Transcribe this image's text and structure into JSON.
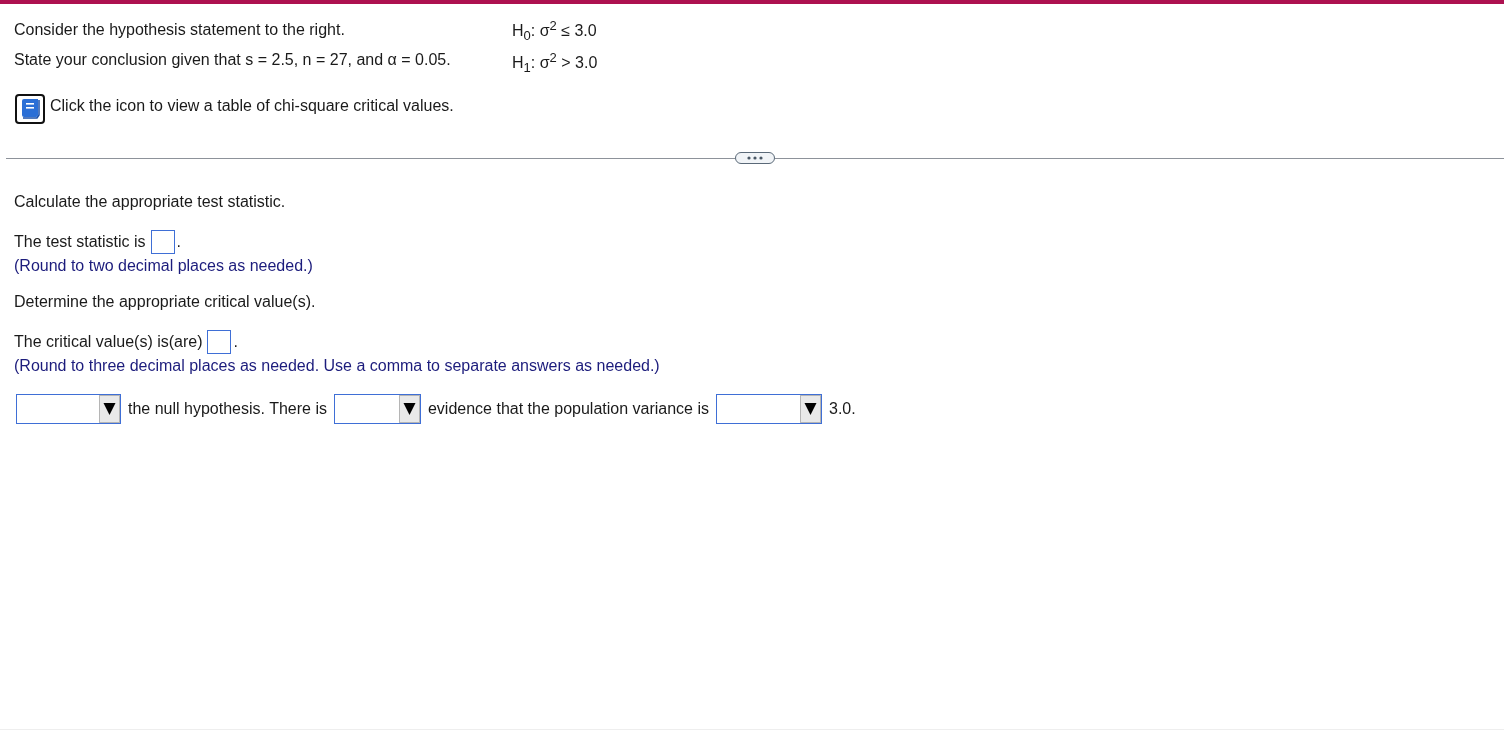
{
  "problem": {
    "statements": [
      "Consider the hypothesis statement to the right.",
      "State your conclusion given that s = 2.5, n = 27, and α = 0.05."
    ],
    "hypotheses": [
      "H$_{0}$: σ$^{2}$ ≤ 3.0",
      "H$_{1}$: σ$^{2}$ > 3.0"
    ],
    "table_note": "Click the icon to view a table of chi-square critical values."
  },
  "parts": [
    {
      "kind": "prompt",
      "text": "Calculate the appropriate test statistic."
    },
    {
      "kind": "answer",
      "label": "The test statistic is",
      "after": "."
    },
    {
      "kind": "hint",
      "text": "(Round to two decimal places as needed.)"
    },
    {
      "kind": "prompt",
      "text": "Determine the appropriate critical value(s)."
    },
    {
      "kind": "answer",
      "label": "The critical value(s) is(are)",
      "after": "."
    },
    {
      "kind": "hint",
      "text": "(Round to three decimal places as needed. Use a comma to separate answers as needed.)"
    },
    {
      "kind": "conclusion",
      "pieces": [
        {
          "kind": "dropdown"
        },
        {
          "kind": "text",
          "text": "the null hypothesis. There is"
        },
        {
          "kind": "dropdown"
        },
        {
          "kind": "text",
          "text": "evidence that the population variance is"
        },
        {
          "kind": "dropdown"
        },
        {
          "kind": "text",
          "text": "3.0."
        }
      ]
    }
  ]
}
